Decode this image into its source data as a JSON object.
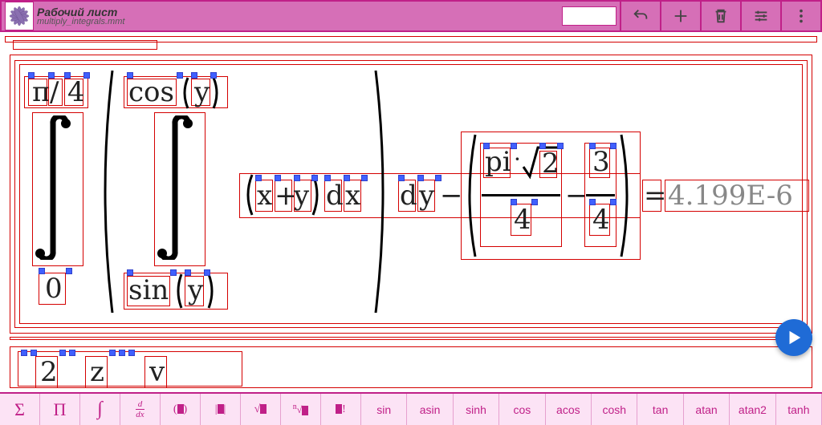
{
  "header": {
    "title": "Рабочий лист",
    "filename": "multiply_integrals.mmt"
  },
  "formula": {
    "int1_upper_left": "π",
    "int1_upper_slash": "/",
    "int1_upper_right": "4",
    "int1_lower": "0",
    "int2_upper_fn": "cos",
    "int2_upper_arg": "y",
    "int2_lower_fn": "sin",
    "int2_lower_arg": "y",
    "inner_a": "x",
    "inner_op": "+",
    "inner_b": "y",
    "diff1_d": "d",
    "diff1_v": "x",
    "diff2_d": "d",
    "diff2_v": "y",
    "minus": "−",
    "rhs_pi": "pi",
    "rhs_dot": "·",
    "rhs_sqrt_arg": "2",
    "rhs_frac1_den": "4",
    "rhs_minus": "−",
    "rhs_frac2_num": "3",
    "rhs_frac2_den": "4",
    "equals": "=",
    "result": "4.199E-6"
  },
  "row2": {
    "a": "2",
    "b": "z",
    "c": "v"
  },
  "toolbar": {
    "sum": "Σ",
    "prod": "Π",
    "int": "∫",
    "deriv": "d/dx",
    "paren": "(▮)",
    "abs": "|▮|",
    "sqrt": "√▮",
    "nroot": "ⁿ√▮",
    "fact": "▮!",
    "sin": "sin",
    "asin": "asin",
    "sinh": "sinh",
    "cos": "cos",
    "acos": "acos",
    "cosh": "cosh",
    "tan": "tan",
    "atan": "atan",
    "atan2": "atan2",
    "tanh": "tanh"
  }
}
